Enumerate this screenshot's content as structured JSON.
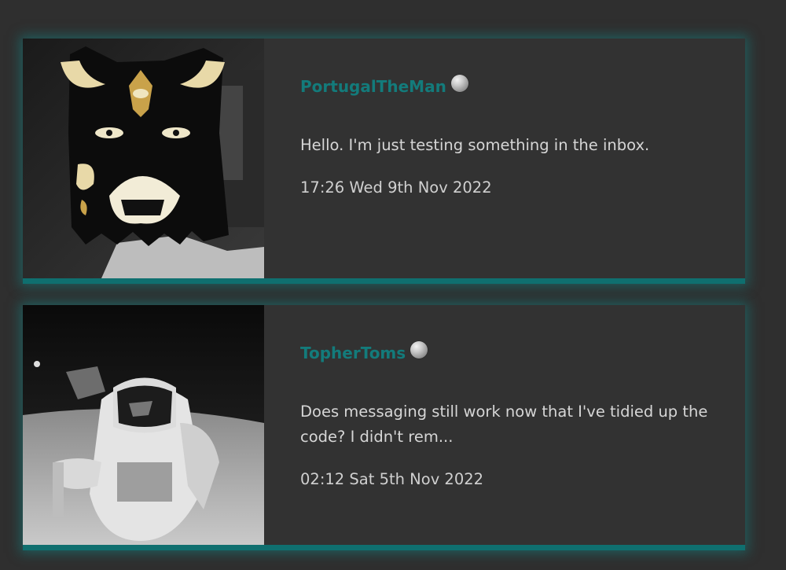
{
  "messages": [
    {
      "username": "PortugalTheMan",
      "status_icon": "status-dot-icon",
      "preview": "Hello. I'm just testing something in the inbox.",
      "timestamp": "17:26 Wed 9th Nov 2022"
    },
    {
      "username": "TopherToms",
      "status_icon": "status-dot-icon",
      "preview": "Does messaging still work now that I've tidied up the code? I didn't rem...",
      "timestamp": "02:12 Sat 5th Nov 2022"
    }
  ],
  "colors": {
    "background": "#2f2f2f",
    "card": "#323232",
    "accent": "#137b7b",
    "text": "#d4d4d4"
  }
}
